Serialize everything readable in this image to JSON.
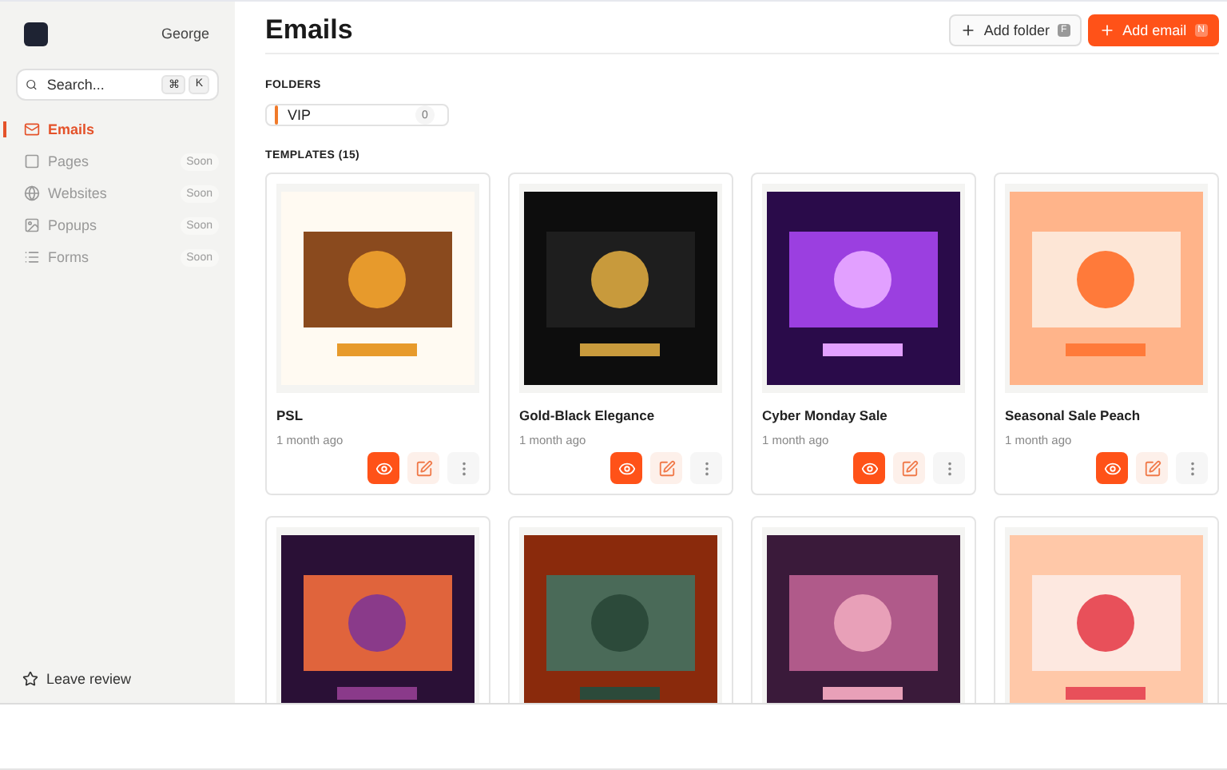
{
  "sidebar": {
    "user": "George",
    "search": {
      "placeholder": "Search...",
      "keys": [
        "⌘",
        "K"
      ]
    },
    "nav": [
      {
        "label": "Emails",
        "selected": true
      },
      {
        "label": "Pages",
        "selected": false,
        "badge": "Soon"
      },
      {
        "label": "Websites",
        "selected": false,
        "badge": "Soon"
      },
      {
        "label": "Popups",
        "selected": false,
        "badge": "Soon"
      },
      {
        "label": "Forms",
        "selected": false,
        "badge": "Soon"
      }
    ],
    "footer": "Leave review"
  },
  "header": {
    "title": "Emails",
    "buttons": [
      {
        "label": "Add folder",
        "key": "F",
        "kind": "secondary"
      },
      {
        "label": "Add email",
        "key": "N",
        "kind": "primary"
      }
    ]
  },
  "folders": {
    "heading": "FOLDERS",
    "items": [
      {
        "name": "VIP",
        "count": "0"
      }
    ]
  },
  "templates": {
    "heading": "TEMPLATES (15)",
    "items": [
      {
        "name": "PSL",
        "age": "1 month ago"
      },
      {
        "name": "Gold-Black Elegance",
        "age": "1 month ago"
      },
      {
        "name": "Cyber Monday Sale",
        "age": "1 month ago"
      },
      {
        "name": "Seasonal Sale Peach",
        "age": "1 month ago"
      }
    ]
  }
}
